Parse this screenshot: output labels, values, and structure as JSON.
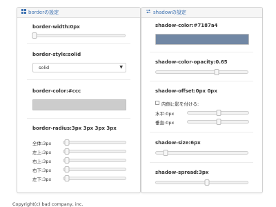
{
  "left_panel": {
    "title": "borderの設定",
    "border_width": {
      "label": "border-width:0px",
      "value": 0
    },
    "border_style": {
      "label": "border-style:solid",
      "selected": "solid"
    },
    "border_color": {
      "label": "border-color:#ccc",
      "color": "#cccccc"
    },
    "border_radius": {
      "label": "border-radius:3px 3px 3px 3px",
      "rows": [
        {
          "label": "全体:3px",
          "value": 0.05
        },
        {
          "label": "左上:3px",
          "value": 0.05
        },
        {
          "label": "右上:3px",
          "value": 0.05
        },
        {
          "label": "右下:3px",
          "value": 0.05
        },
        {
          "label": "左下:3px",
          "value": 0.05
        }
      ]
    }
  },
  "right_panel": {
    "title": "shadowの設定",
    "shadow_color": {
      "label": "shadow-color:#7187a4",
      "color": "#7187a4"
    },
    "shadow_opacity": {
      "label": "shadow-color-opacity:0.65",
      "value": 0.65
    },
    "shadow_offset": {
      "label": "shadow-offset:0px 0px",
      "inset_label": "内側に影を付ける:",
      "horizontal": {
        "label": "水平:0px",
        "value": 0.5
      },
      "vertical": {
        "label": "垂直:0px",
        "value": 0.5
      }
    },
    "shadow_size": {
      "label": "shadow-size:6px",
      "value": 0.1
    },
    "shadow_spread": {
      "label": "shadow-spread:3px",
      "value": 0.55
    }
  },
  "footer": {
    "text": "Copyright(c) bad company, inc."
  }
}
